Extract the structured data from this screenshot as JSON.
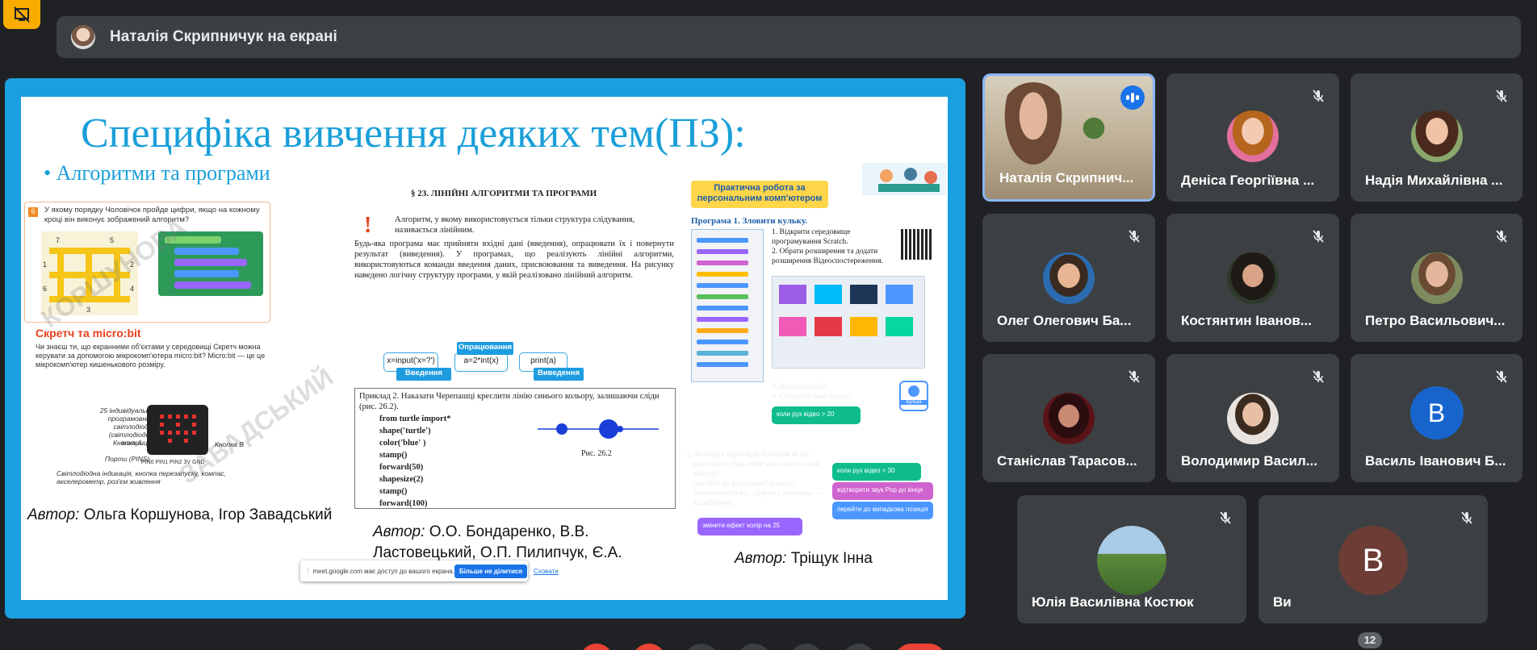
{
  "presenter_bar": {
    "text": "Наталія Скрипничук на екрані"
  },
  "slide": {
    "title": "Специфіка вивчення деяких тем(ПЗ):",
    "bullet": "Алгоритми та програми",
    "page1": {
      "task_number": "6",
      "task_question": "У якому порядку Чоловічок пройде цифри, якщо на кожному кроці він виконує зображений алгоритм?",
      "maze_labels": [
        "7",
        "5",
        "1",
        "2",
        "4",
        "6",
        "3"
      ],
      "subheading": "Скретч та micro:bit",
      "paragraph": "Чи знаєш ти, що екранними об'єктами у середовищі Скретч можна керувати за допомогою мікрокомп'ютера micro:bit? Micro:bit — це це мікрокомп'ютер кишенькового розміру.",
      "labels": {
        "matrix": "25 індивідуально програмовних світлодіодів (світлодіодна матриця)",
        "button_a": "Кнопка А",
        "ports": "Порти (PINS)",
        "button_b": "Кнопка B",
        "pins": "PIN0  PIN1  PIN2  3V  GND",
        "caption": "Світлодіодна індикація, кнопка перезапуску, компас, акселерометр, роз'єм живлення"
      },
      "watermark": "КОРШУНОВА ЗАВАДСЬКИЙ",
      "author_prefix": "Автор:",
      "author_names": "Ольга Коршунова, Ігор Завадський"
    },
    "page2": {
      "section": "§ 23. ЛІНІЙНІ АЛГОРИТМИ ТА ПРОГРАМИ",
      "definition": "Алгоритм, у якому використовується тільки структура слідування, називається лінійним.",
      "body": "Будь-яка програма має прийняти вхідні дані (введення), опрацювати їх і повернути результат (виведення). У програмах, що реалізують лінійні алгоритми, використовуються команди введення даних, присвоювання та виведення. На рисунку наведено логічну структуру програми, у якій реалізовано лінійний алгоритм.",
      "flow": {
        "box1": "x=input('x=?')",
        "tag1": "Введення",
        "box2": "a=2*int(x)",
        "tag2": "Опрацювання",
        "box3": "print(a)",
        "tag3": "Виведення"
      },
      "example_head": "Приклад 2. Наказати Черепашці креслити лінію синього кольору, залишаючи сліди (рис. 26.2).",
      "code": [
        "from turtle import*",
        "shape('turtle')",
        "color('blue' )",
        "stamp()",
        "forward(50)",
        "shapesize(2)",
        "stamp()",
        "forward(100)"
      ],
      "figure_caption": "Рис. 26.2",
      "author_prefix": "Автор:",
      "author_names": "О.О. Бондаренко, В.В. Ластовецький, О.П. Пилипчук, Є.А. Шестопалов"
    },
    "page3": {
      "banner": "Практична робота за персональним комп'ютером",
      "program": "Програма 1. Зловити кульку.",
      "steps_a": [
        "1. Відкрити середовище програмування Scratch.",
        "2. Обрати розширення та додати розширення Відеоспостереження."
      ],
      "steps_b": [
        "3. Додати спрайт.",
        "4. Створити нову подію."
      ],
      "block1": "коли рух відео >  20",
      "block2": "коли рух відео >  30",
      "block3": "відтворити звук  Pop  до кінця",
      "block4": "перейти до  випадкова позиція",
      "block5": "змінити ефект  колір  на  25",
      "sprite_label": "Кулька",
      "steps_c": [
        "5. Коли рух відео буде більшим за 20:",
        "відтворити будь-який звук (на власний розсуд);",
        "перейти до випадкової позиції;",
        "змінити колір на... (ефект і показник — за вибором)."
      ],
      "author_prefix": "Автор:",
      "author_names": "Тріщук Інна"
    },
    "share_popup": {
      "message": "meet.google.com має доступ до вашого екрана.",
      "stop_label": "Більше не ділитися",
      "hide_label": "Сховати"
    }
  },
  "participants": [
    {
      "name": "Наталія Скрипнич...",
      "state": "speaking"
    },
    {
      "name": "Деніса Георгіївна ...",
      "state": "muted"
    },
    {
      "name": "Надія Михайлівна ...",
      "state": "muted"
    },
    {
      "name": "Олег Олегович Ба...",
      "state": "muted"
    },
    {
      "name": "Костянтин Іванов...",
      "state": "muted"
    },
    {
      "name": "Петро Васильович...",
      "state": "muted"
    },
    {
      "name": "Станіслав Тарасов...",
      "state": "muted"
    },
    {
      "name": "Володимир Васил...",
      "state": "muted"
    },
    {
      "name": "Василь Іванович Б...",
      "state": "muted",
      "initial": "В"
    },
    {
      "name": "Юлія Василівна Костюк",
      "state": "muted"
    },
    {
      "name": "Ви",
      "state": "muted",
      "initial": "В"
    }
  ],
  "participant_count": "12",
  "colors": {
    "background": "#202124",
    "tile": "#3c4043",
    "accent": "#1a73e8",
    "stage_border": "#1a9fe0",
    "warning": "#f9ab00"
  }
}
